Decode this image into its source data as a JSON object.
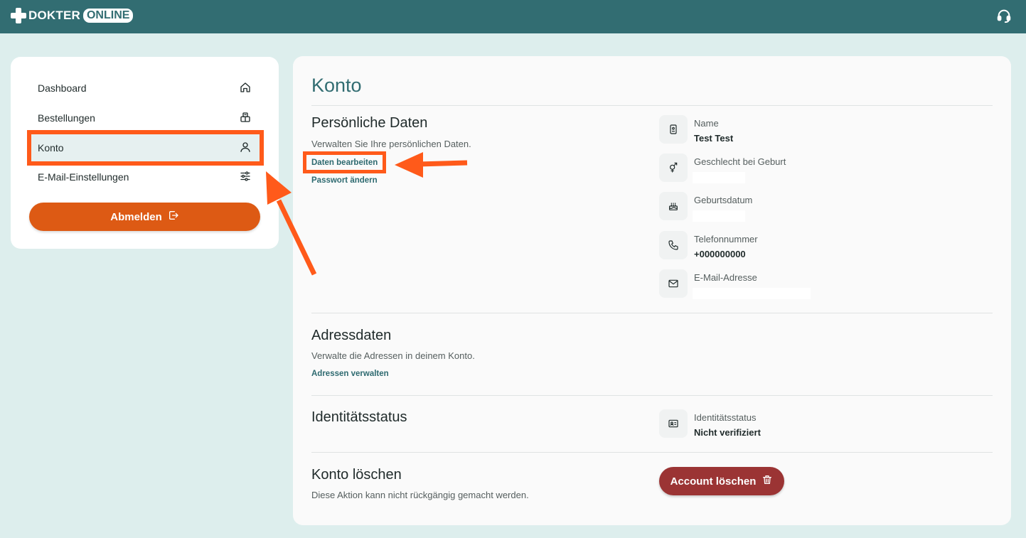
{
  "header": {
    "logo_part1": "DOKTER",
    "logo_part2": "ONLINE",
    "support_icon": "headset-icon"
  },
  "sidebar": {
    "items": [
      {
        "label": "Dashboard",
        "icon": "home-icon"
      },
      {
        "label": "Bestellungen",
        "icon": "package-icon"
      },
      {
        "label": "Konto",
        "icon": "user-icon"
      },
      {
        "label": "E-Mail-Einstellungen",
        "icon": "sliders-icon"
      }
    ],
    "logout_label": "Abmelden"
  },
  "main": {
    "title": "Konto",
    "personal": {
      "title": "Persönliche Daten",
      "description": "Verwalten Sie Ihre persönlichen Daten.",
      "edit_link": "Daten bearbeiten",
      "password_link": "Passwort ändern",
      "fields": [
        {
          "label": "Name",
          "value": "Test Test",
          "icon": "id-badge-icon"
        },
        {
          "label": "Geschlecht bei Geburt",
          "value": "",
          "icon": "gender-icon"
        },
        {
          "label": "Geburtsdatum",
          "value": "",
          "icon": "cake-icon"
        },
        {
          "label": "Telefonnummer",
          "value": "+000000000",
          "icon": "phone-icon"
        },
        {
          "label": "E-Mail-Adresse",
          "value": "",
          "icon": "mail-icon"
        }
      ]
    },
    "address": {
      "title": "Adressdaten",
      "description": "Verwalte die Adressen in deinem Konto.",
      "manage_link": "Adressen verwalten"
    },
    "identity": {
      "title": "Identitätsstatus",
      "label": "Identitätsstatus",
      "value": "Nicht verifiziert",
      "icon": "id-card-icon"
    },
    "delete": {
      "title": "Konto löschen",
      "description": "Diese Aktion kann nicht rückgängig gemacht werden.",
      "button_label": "Account löschen"
    }
  },
  "colors": {
    "header_bg": "#326d72",
    "page_bg": "#ddeeed",
    "logout_btn": "#dd5a14",
    "delete_btn": "#9b3434",
    "annotation": "#ff5a1a"
  }
}
